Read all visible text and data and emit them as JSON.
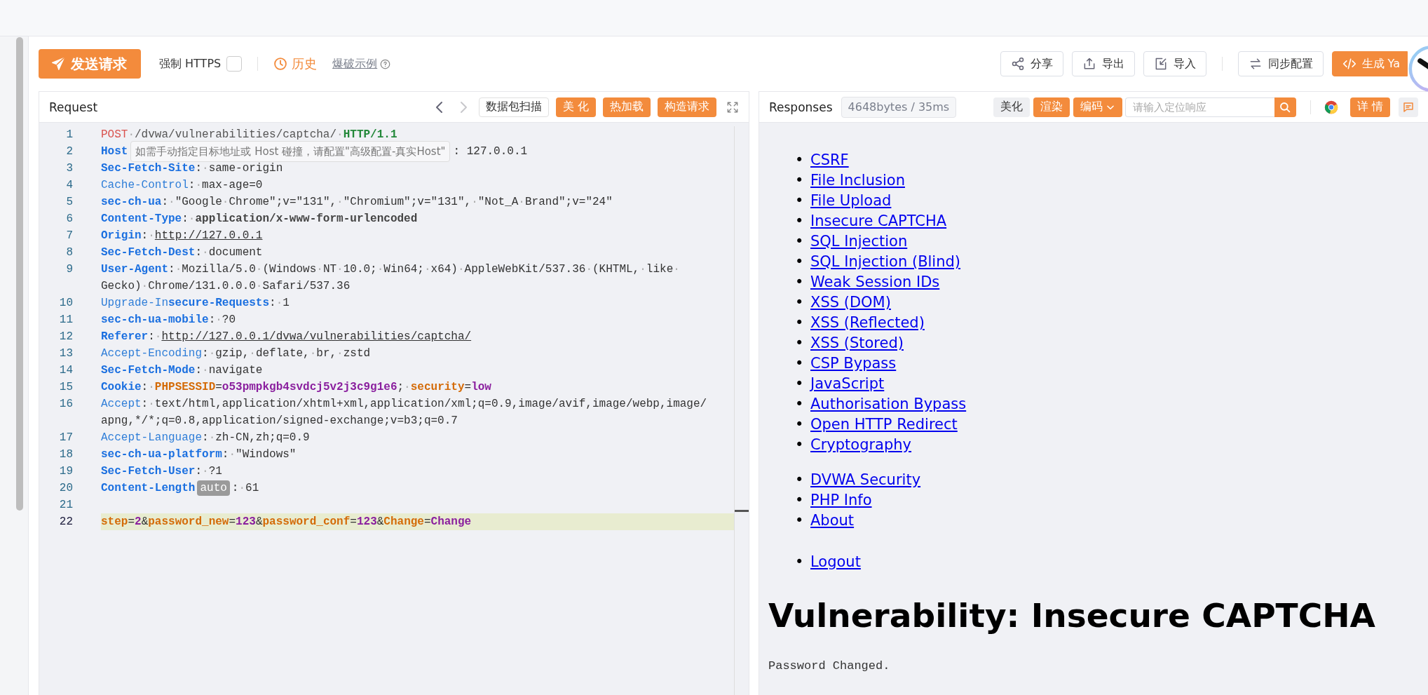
{
  "toolbar": {
    "send_button": "发送请求",
    "force_https": {
      "label": "强制 HTTPS",
      "checked": false
    },
    "history": "历史",
    "example_link": "爆破示例",
    "actions": [
      {
        "kind": "share",
        "label": "分享"
      },
      {
        "kind": "export",
        "label": "导出"
      },
      {
        "kind": "import",
        "label": "导入"
      },
      {
        "kind": "sync",
        "label": "同步配置"
      },
      {
        "kind": "generate",
        "label": "生成 Ya"
      }
    ]
  },
  "request": {
    "title": "Request",
    "nav": [
      {
        "kind": "back",
        "disabled": false
      },
      {
        "kind": "forward",
        "disabled": true
      }
    ],
    "buttons": [
      {
        "kind": "plain",
        "label": "数据包扫描"
      },
      {
        "kind": "accent",
        "label": "美 化"
      },
      {
        "kind": "accent",
        "label": "热加载"
      },
      {
        "kind": "accent",
        "label": "构造请求"
      }
    ],
    "lines": [
      {
        "number": "1",
        "current": false,
        "rows": [
          [
            {
              "kind": "method",
              "text": "POST"
            },
            {
              "kind": "path",
              "text": "·/dvwa/vulnerabilities/captcha/·"
            },
            {
              "kind": "version",
              "text": "HTTP/1.1"
            }
          ]
        ]
      },
      {
        "number": "2",
        "current": false,
        "rows": [
          [
            {
              "kind": "key-bold",
              "text": "Host"
            },
            {
              "kind": "hint",
              "text": "如需手动指定目标地址或 Host 碰撞，请配置\"高级配置-真实Host\""
            },
            {
              "kind": "value",
              "text": ": 127.0.0.1"
            }
          ]
        ]
      },
      {
        "number": "3",
        "current": false,
        "rows": [
          [
            {
              "kind": "key-bold",
              "text": "Sec-Fetch-Site"
            },
            {
              "kind": "value",
              "text": ":·same-origin"
            }
          ]
        ]
      },
      {
        "number": "4",
        "current": false,
        "rows": [
          [
            {
              "kind": "key",
              "text": "Cache-Control"
            },
            {
              "kind": "value",
              "text": ":·max-age=0"
            }
          ]
        ]
      },
      {
        "number": "5",
        "current": false,
        "rows": [
          [
            {
              "kind": "key-bold",
              "text": "sec-ch-ua"
            },
            {
              "kind": "value",
              "text": ":·\"Google·Chrome\";v=\"131\",·\"Chromium\";v=\"131\",·\"Not_A·Brand\";v=\"24\""
            }
          ]
        ]
      },
      {
        "number": "6",
        "current": false,
        "rows": [
          [
            {
              "kind": "key-bold",
              "text": "Content-Type"
            },
            {
              "kind": "value",
              "text": ":·"
            },
            {
              "kind": "value-bold",
              "text": "application/x-www-form-urlencoded"
            }
          ]
        ]
      },
      {
        "number": "7",
        "current": false,
        "rows": [
          [
            {
              "kind": "key-bold",
              "text": "Origin"
            },
            {
              "kind": "value",
              "text": ":·"
            },
            {
              "kind": "url",
              "text": "http://127.0.0.1"
            }
          ]
        ]
      },
      {
        "number": "8",
        "current": false,
        "rows": [
          [
            {
              "kind": "key-bold",
              "text": "Sec-Fetch-Dest"
            },
            {
              "kind": "value",
              "text": ":·document"
            }
          ]
        ]
      },
      {
        "number": "9",
        "current": false,
        "rows": [
          [
            {
              "kind": "key-bold",
              "text": "User-Agent"
            },
            {
              "kind": "value",
              "text": ":·Mozilla/5.0·(Windows·NT·10.0;·Win64;·x64)·AppleWebKit/537.36·(KHTML,·like·"
            }
          ],
          [
            {
              "kind": "value",
              "text": "Gecko)·Chrome/131.0.0.0·Safari/537.36"
            }
          ]
        ]
      },
      {
        "number": "10",
        "current": false,
        "rows": [
          [
            {
              "kind": "key",
              "text": "Upgrade-In"
            },
            {
              "kind": "key-bold",
              "text": "secure-Requests"
            },
            {
              "kind": "value",
              "text": ":·1"
            }
          ]
        ]
      },
      {
        "number": "11",
        "current": false,
        "rows": [
          [
            {
              "kind": "key-bold",
              "text": "sec-ch-ua-mobile"
            },
            {
              "kind": "value",
              "text": ":·?0"
            }
          ]
        ]
      },
      {
        "number": "12",
        "current": false,
        "rows": [
          [
            {
              "kind": "key-bold",
              "text": "Referer"
            },
            {
              "kind": "value",
              "text": ":·"
            },
            {
              "kind": "url",
              "text": "http://127.0.0.1/dvwa/vulnerabilities/captcha/"
            }
          ]
        ]
      },
      {
        "number": "13",
        "current": false,
        "rows": [
          [
            {
              "kind": "key",
              "text": "Accept-Encoding"
            },
            {
              "kind": "value",
              "text": ":·gzip,·deflate,·br,·zstd"
            }
          ]
        ]
      },
      {
        "number": "14",
        "current": false,
        "rows": [
          [
            {
              "kind": "key-bold",
              "text": "Sec-Fetch-Mode"
            },
            {
              "kind": "value",
              "text": ":·navigate"
            }
          ]
        ]
      },
      {
        "number": "15",
        "current": false,
        "rows": [
          [
            {
              "kind": "key-bold",
              "text": "Cookie"
            },
            {
              "kind": "value",
              "text": ":·"
            },
            {
              "kind": "cookie-name",
              "text": "PHPSESSID"
            },
            {
              "kind": "punct",
              "text": "="
            },
            {
              "kind": "cookie-value",
              "text": "o53pmpkgb4svdcj5v2j3c9g1e6"
            },
            {
              "kind": "value",
              "text": ";·"
            },
            {
              "kind": "cookie-name",
              "text": "security"
            },
            {
              "kind": "punct",
              "text": "="
            },
            {
              "kind": "cookie-value",
              "text": "low"
            }
          ]
        ]
      },
      {
        "number": "16",
        "current": false,
        "rows": [
          [
            {
              "kind": "key",
              "text": "Accept"
            },
            {
              "kind": "value",
              "text": ":·text/html,application/xhtml+xml,application/xml;q=0.9,image/avif,image/webp,image/"
            }
          ],
          [
            {
              "kind": "value",
              "text": "apng,*/*;q=0.8,application/signed-exchange;v=b3;q=0.7"
            }
          ]
        ]
      },
      {
        "number": "17",
        "current": false,
        "rows": [
          [
            {
              "kind": "key",
              "text": "Accept-Language"
            },
            {
              "kind": "value",
              "text": ":·zh-CN,zh;q=0.9"
            }
          ]
        ]
      },
      {
        "number": "18",
        "current": false,
        "rows": [
          [
            {
              "kind": "key-bold",
              "text": "sec-ch-ua-platform"
            },
            {
              "kind": "value",
              "text": ":·\"Windows\""
            }
          ]
        ]
      },
      {
        "number": "19",
        "current": false,
        "rows": [
          [
            {
              "kind": "key-bold",
              "text": "Sec-Fetch-User"
            },
            {
              "kind": "value",
              "text": ":·?1"
            }
          ]
        ]
      },
      {
        "number": "20",
        "current": false,
        "rows": [
          [
            {
              "kind": "key-bold",
              "text": "Content-Length"
            },
            {
              "kind": "badge",
              "text": "auto"
            },
            {
              "kind": "value",
              "text": ":·61"
            }
          ]
        ]
      },
      {
        "number": "21",
        "current": false
      },
      {
        "number": "22",
        "current": true,
        "rows": [
          [
            {
              "kind": "param-name",
              "text": "step"
            },
            {
              "kind": "punct",
              "text": "="
            },
            {
              "kind": "param-value",
              "text": "2"
            },
            {
              "kind": "punct",
              "text": "&"
            },
            {
              "kind": "param-name",
              "text": "password_new"
            },
            {
              "kind": "punct",
              "text": "="
            },
            {
              "kind": "param-value",
              "text": "123"
            },
            {
              "kind": "punct",
              "text": "&"
            },
            {
              "kind": "param-name",
              "text": "password_conf"
            },
            {
              "kind": "punct",
              "text": "="
            },
            {
              "kind": "param-value",
              "text": "123"
            },
            {
              "kind": "punct",
              "text": "&"
            },
            {
              "kind": "param-name",
              "text": "Change"
            },
            {
              "kind": "punct",
              "text": "="
            },
            {
              "kind": "param-value",
              "text": "Change"
            }
          ]
        ]
      }
    ]
  },
  "response": {
    "title": "Responses",
    "stats": "4648bytes / 35ms",
    "buttons": [
      {
        "kind": "plain",
        "label": "美化"
      },
      {
        "kind": "accent",
        "label": "渲染"
      },
      {
        "kind": "dropdown",
        "label": "编码"
      }
    ],
    "search": {
      "placeholder": "请输入定位响应"
    },
    "detail_button": "详 情",
    "body": {
      "link_groups": [
        {
          "marker": "•",
          "links": [
            "CSRF",
            "File Inclusion",
            "File Upload",
            "Insecure CAPTCHA",
            "SQL Injection",
            "SQL Injection (Blind)",
            "Weak Session IDs",
            "XSS (DOM)",
            "XSS (Reflected)",
            "XSS (Stored)",
            "CSP Bypass",
            "JavaScript",
            "Authorisation Bypass",
            "Open HTTP Redirect",
            "Cryptography"
          ]
        },
        {
          "marker": "•",
          "links": [
            "DVWA Security",
            "PHP Info",
            "About"
          ]
        },
        {
          "marker": "•",
          "links": [
            "Logout"
          ]
        }
      ],
      "heading": "Vulnerability: Insecure CAPTCHA",
      "message": "Password Changed."
    }
  }
}
